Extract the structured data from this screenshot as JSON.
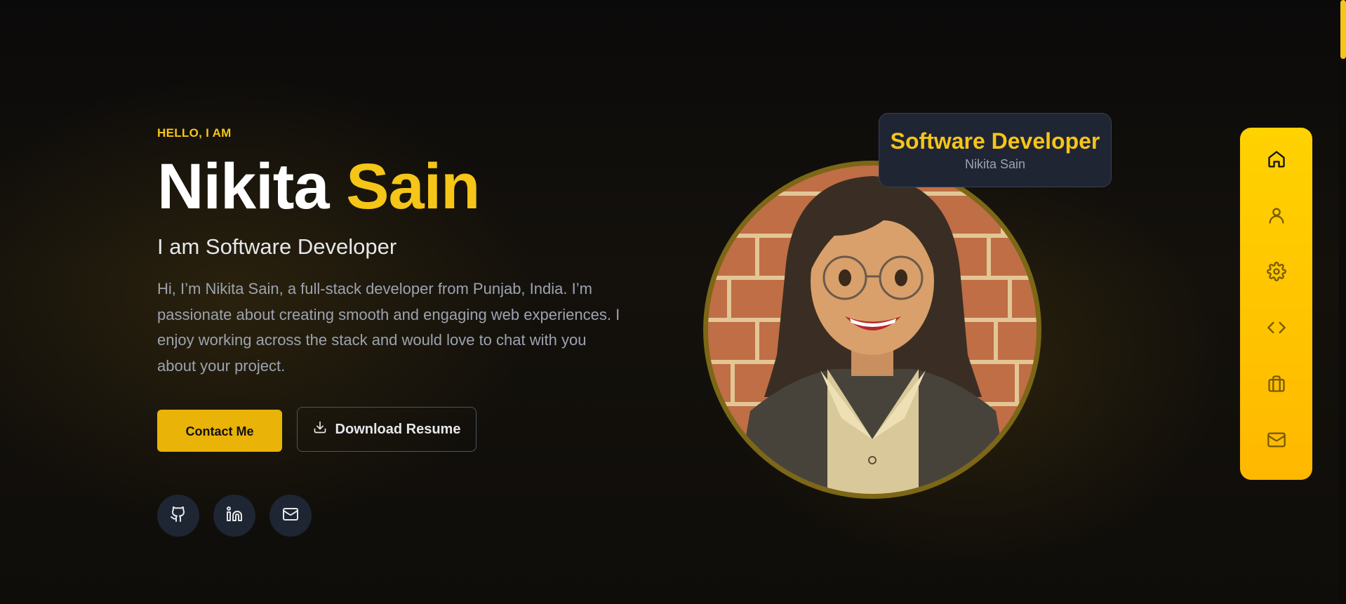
{
  "hero": {
    "greeting": "HELLO, I AM",
    "first_name": "Nikita",
    "last_name": "Sain",
    "role": "I am Software Developer",
    "bio": "Hi, I’m Nikita Sain, a full-stack developer from Punjab, India. I’m passionate about creating smooth and engaging web experiences. I enjoy working across the stack and would love to chat with you about your project.",
    "contact_label": "Contact Me",
    "resume_label": "Download Resume"
  },
  "socials": [
    {
      "icon": "github-icon"
    },
    {
      "icon": "linkedin-icon"
    },
    {
      "icon": "mail-icon"
    }
  ],
  "badge": {
    "title": "Software Developer",
    "subtitle": "Nikita Sain"
  },
  "side_nav": [
    {
      "icon": "home-icon"
    },
    {
      "icon": "user-icon"
    },
    {
      "icon": "gear-icon"
    },
    {
      "icon": "code-icon"
    },
    {
      "icon": "briefcase-icon"
    },
    {
      "icon": "mail-icon"
    }
  ],
  "colors": {
    "accent": "#f5c518",
    "button": "#eab308",
    "background": "#0c0b0a",
    "card": "#1f2533"
  }
}
